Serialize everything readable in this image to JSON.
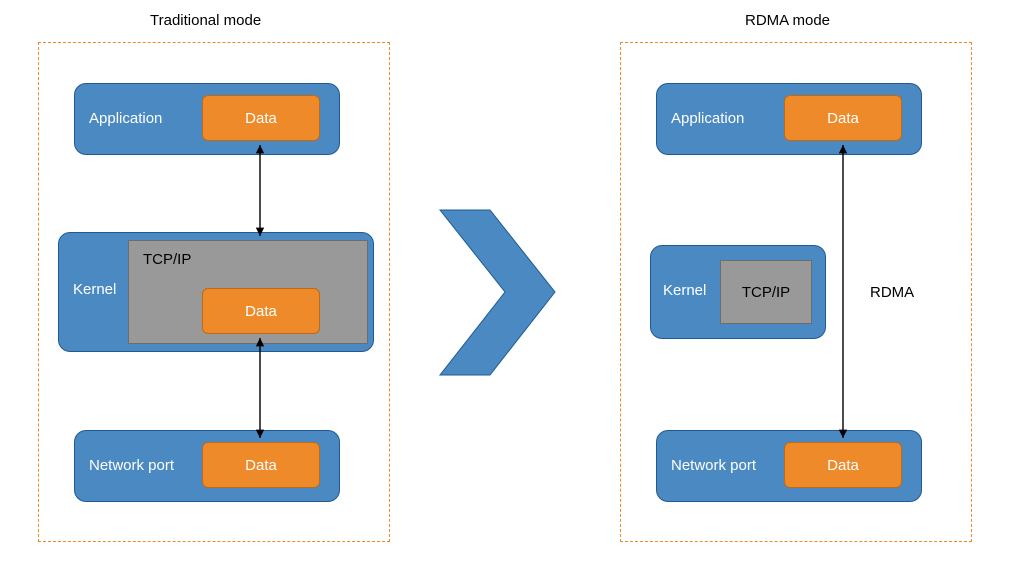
{
  "titles": {
    "left": "Traditional mode",
    "right": "RDMA mode"
  },
  "labels": {
    "application": "Application",
    "kernel": "Kernel",
    "tcpip": "TCP/IP",
    "network_port": "Network port",
    "data": "Data",
    "rdma": "RDMA"
  },
  "colors": {
    "blue_fill": "#4a89c2",
    "blue_stroke": "#1f5a93",
    "orange_fill": "#ee8a2a",
    "orange_stroke": "#c06a13",
    "grey_fill": "#999999",
    "grey_stroke": "#6d6d6d",
    "dashed_stroke": "#ee8a2a",
    "arrow": "#000000"
  }
}
